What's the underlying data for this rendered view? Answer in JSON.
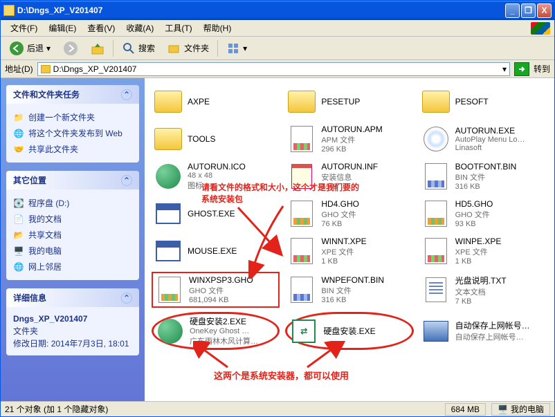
{
  "title": "D:\\Dngs_XP_V201407",
  "window_controls": {
    "min": "_",
    "max": "❐",
    "close": "X"
  },
  "menu": [
    "文件(F)",
    "编辑(E)",
    "查看(V)",
    "收藏(A)",
    "工具(T)",
    "帮助(H)"
  ],
  "toolbar": {
    "back": "后退",
    "search": "搜索",
    "folders": "文件夹"
  },
  "address": {
    "label": "地址(D)",
    "value": "D:\\Dngs_XP_V201407",
    "go": "转到"
  },
  "sidebar": {
    "tasks": {
      "title": "文件和文件夹任务",
      "items": [
        "创建一个新文件夹",
        "将这个文件夹发布到 Web",
        "共享此文件夹"
      ]
    },
    "other": {
      "title": "其它位置",
      "items": [
        "程序盘 (D:)",
        "我的文档",
        "共享文档",
        "我的电脑",
        "网上邻居"
      ]
    },
    "detail": {
      "title": "详细信息",
      "name": "Dngs_XP_V201407",
      "type": "文件夹",
      "mod_label": "修改日期:",
      "mod_value": "2014年7月3日, 18:01"
    }
  },
  "files": [
    {
      "name": "AXPE",
      "icon": "folder"
    },
    {
      "name": "PESETUP",
      "icon": "folder"
    },
    {
      "name": "PESOFT",
      "icon": "folder"
    },
    {
      "name": "TOOLS",
      "icon": "folder"
    },
    {
      "name": "AUTORUN.APM",
      "sub1": "APM 文件",
      "sub2": "296 KB",
      "icon": "doc"
    },
    {
      "name": "AUTORUN.EXE",
      "sub1": "AutoPlay Menu Lo…",
      "sub2": "Linasoft",
      "icon": "cd"
    },
    {
      "name": "AUTORUN.ICO",
      "sub1": "48 x 48",
      "sub2": "图标",
      "icon": "green"
    },
    {
      "name": "AUTORUN.INF",
      "sub1": "安装信息",
      "sub2": "1 KB",
      "icon": "note"
    },
    {
      "name": "BOOTFONT.BIN",
      "sub1": "BIN 文件",
      "sub2": "316 KB",
      "icon": "bin"
    },
    {
      "name": "GHOST.EXE",
      "icon": "app"
    },
    {
      "name": "HD4.GHO",
      "sub1": "GHO 文件",
      "sub2": "76 KB",
      "icon": "gho"
    },
    {
      "name": "HD5.GHO",
      "sub1": "GHO 文件",
      "sub2": "93 KB",
      "icon": "gho"
    },
    {
      "name": "MOUSE.EXE",
      "icon": "app"
    },
    {
      "name": "WINNT.XPE",
      "sub1": "XPE 文件",
      "sub2": "1 KB",
      "icon": "doc"
    },
    {
      "name": "WINPE.XPE",
      "sub1": "XPE 文件",
      "sub2": "1 KB",
      "icon": "doc"
    },
    {
      "name": "WINXPSP3.GHO",
      "sub1": "GHO 文件",
      "sub2": "681,094 KB",
      "icon": "gho",
      "highlight": "redbox"
    },
    {
      "name": "WNPEFONT.BIN",
      "sub1": "BIN 文件",
      "sub2": "316 KB",
      "icon": "bin"
    },
    {
      "name": "光盘说明.TXT",
      "sub1": "文本文档",
      "sub2": "7 KB",
      "icon": "txt"
    },
    {
      "name": "硬盘安装2.EXE",
      "sub1": "OneKey Ghost …",
      "sub2": "广东雨林木风计算…",
      "icon": "green",
      "highlight": "redcircle"
    },
    {
      "name": "硬盘安装.EXE",
      "icon": "sqgreen",
      "highlight": "redcircle"
    },
    {
      "name": "自动保存上网帐号密码到D盘.EXE",
      "sub1": "自动保存上网帐号…",
      "icon": "pc"
    }
  ],
  "annotations": {
    "a1_l1": "请看文件的格式和大小，这个才是我们要的",
    "a1_l2": "系统安装包",
    "a2": "这两个是系统安装器，都可以使用"
  },
  "status": {
    "left": "21 个对象 (加 1 个隐藏对象)",
    "size": "684 MB",
    "right": "我的电脑"
  }
}
